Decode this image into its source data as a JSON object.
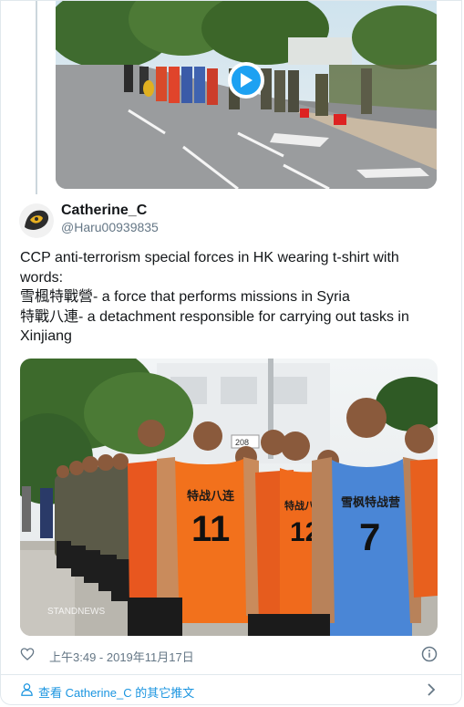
{
  "tweet": {
    "display_name": "Catherine_C",
    "handle": "@Haru00939835",
    "text_lines": [
      "CCP anti-terrorism special forces in HK wearing t-shirt with",
      "words:",
      "雪楓特戰營- a force that performs missions in Syria",
      "特戰八連- a detachment responsible for carrying out tasks in",
      "Xinjiang"
    ],
    "timestamp": "上午3:49 - 2019年11月17日"
  },
  "photo": {
    "jersey_labels": [
      "特战八连",
      "雪枫特战营"
    ],
    "jersey_numbers": [
      "11",
      "7",
      "12"
    ],
    "watermark": "STANDNEWS",
    "sign": "208"
  },
  "footer": {
    "link_text": "查看 Catherine_C 的其它推文"
  },
  "colors": {
    "accent": "#1da1f2",
    "link": "#1b95e0",
    "secondary_text": "#657786",
    "border": "#e1e8ed"
  },
  "icons": [
    "play-icon",
    "heart-icon",
    "info-icon",
    "person-icon",
    "chevron-right-icon"
  ]
}
